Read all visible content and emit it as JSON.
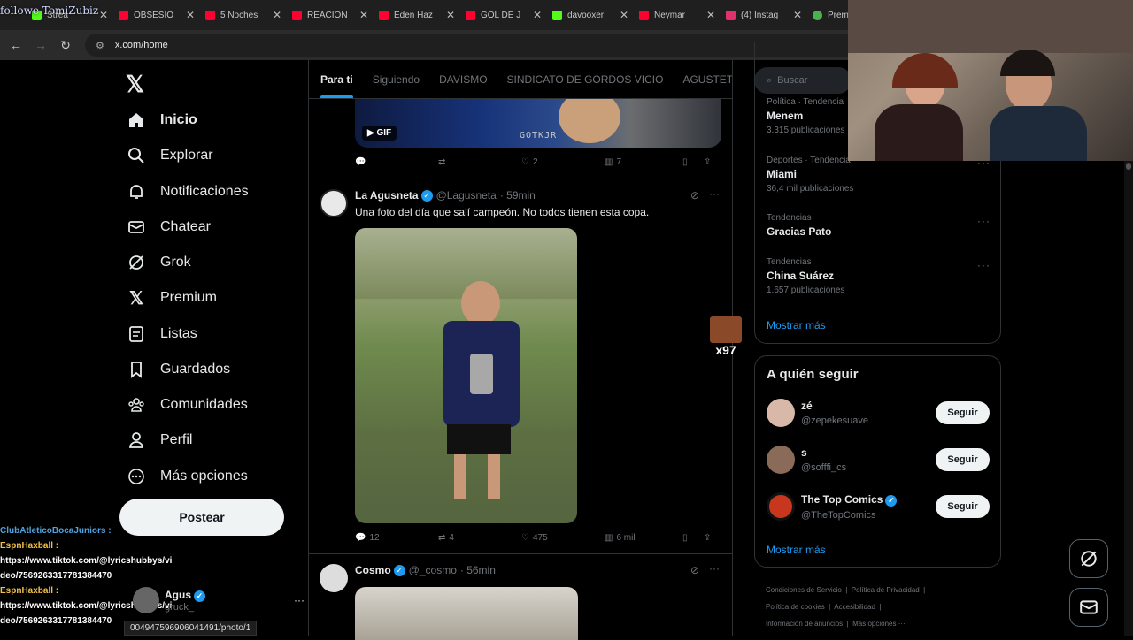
{
  "browser": {
    "overlay_name": "followe TomiZubiz",
    "tabs": [
      {
        "title": "Strea",
        "color": "#53fc18"
      },
      {
        "title": "OBSESIO",
        "color": "#ff0033"
      },
      {
        "title": "5 Noches",
        "color": "#ff0033"
      },
      {
        "title": "REACION",
        "color": "#ff0033"
      },
      {
        "title": "Eden Haz",
        "color": "#ff0033"
      },
      {
        "title": "GOL DE J",
        "color": "#ff0033"
      },
      {
        "title": "davooxer",
        "color": "#53fc18"
      },
      {
        "title": "Neymar",
        "color": "#ff0033"
      },
      {
        "title": "(4) Instag",
        "color": "#e1306c"
      },
      {
        "title": "Prem",
        "color": "#4caf50"
      }
    ],
    "url": "x.com/home"
  },
  "nav": {
    "items": [
      {
        "label": "Inicio",
        "icon": "home-icon"
      },
      {
        "label": "Explorar",
        "icon": "search-icon"
      },
      {
        "label": "Notificaciones",
        "icon": "bell-icon"
      },
      {
        "label": "Chatear",
        "icon": "mail-icon"
      },
      {
        "label": "Grok",
        "icon": "grok-icon"
      },
      {
        "label": "Premium",
        "icon": "x-icon"
      },
      {
        "label": "Listas",
        "icon": "list-icon"
      },
      {
        "label": "Guardados",
        "icon": "bookmark-icon"
      },
      {
        "label": "Comunidades",
        "icon": "communities-icon"
      },
      {
        "label": "Perfil",
        "icon": "person-icon"
      },
      {
        "label": "Más opciones",
        "icon": "more-icon"
      }
    ],
    "post_label": "Postear",
    "profile_name": "Agus",
    "profile_handle": "gruck_"
  },
  "chat": {
    "user1": "ClubAtleticoBocaJuniors :",
    "user2": "EspnHaxball :",
    "msg1a": "https://www.tiktok.com/@lyricshubbys/vi",
    "msg1b": "deo/7569263317781384470",
    "user3": "EspnHaxball :",
    "msg2a": "https://www.tiktok.com/@lyricshubbys/vi",
    "msg2b": "deo/7569263317781384470"
  },
  "status_url": "004947596906041491/photo/1",
  "timeline": {
    "tabs": [
      "Para ti",
      "Siguiendo",
      "DAVISMO",
      "SINDICATO DE GORDOS VICIO",
      "AGUSTETI"
    ],
    "gif_badge": "GIF",
    "gif_watermark": "GOTKJR",
    "tweet0": {
      "replies": "",
      "retweets": "",
      "likes": "2",
      "views": "7"
    },
    "tweet1": {
      "name": "La Agusneta",
      "handle": "@Lagusneta",
      "time": "· 59min",
      "text": "Una foto del día que salí campeón. No todos tienen esta copa.",
      "replies": "12",
      "retweets": "4",
      "likes": "475",
      "views": "6 mil"
    },
    "tweet2": {
      "name": "Cosmo",
      "handle": "@_cosmo",
      "time": "· 56min"
    }
  },
  "sidebar": {
    "search_placeholder": "Buscar",
    "trends": [
      {
        "meta": "Política · Tendencia",
        "title": "Menem",
        "count": "3.315 publicaciones"
      },
      {
        "meta": "Deportes · Tendencia",
        "title": "Miami",
        "count": "36,4 mil publicaciones"
      },
      {
        "meta": "Tendencias",
        "title": "Gracias Pato",
        "count": ""
      },
      {
        "meta": "Tendencias",
        "title": "China Suárez",
        "count": "1.657 publicaciones"
      }
    ],
    "trends_more": "Mostrar más",
    "who_to_follow": "A quién seguir",
    "follow": [
      {
        "name": "zé",
        "handle": "@zepekesuave",
        "button": "Seguir"
      },
      {
        "name": "s",
        "handle": "@sofffi_cs",
        "button": "Seguir"
      },
      {
        "name": "The Top Comics",
        "handle": "@TheTopComics",
        "button": "Seguir"
      }
    ],
    "follow_more": "Mostrar más",
    "footer": [
      "Condiciones de Servicio",
      "Política de Privacidad",
      "Política de cookies",
      "Accesibilidad",
      "Información de anuncios",
      "Más opciones ···"
    ]
  },
  "emote_label": "x97",
  "colors": {
    "accent": "#1d9bf0",
    "bg": "#000000",
    "border": "#2f3336",
    "muted": "#71767b"
  }
}
